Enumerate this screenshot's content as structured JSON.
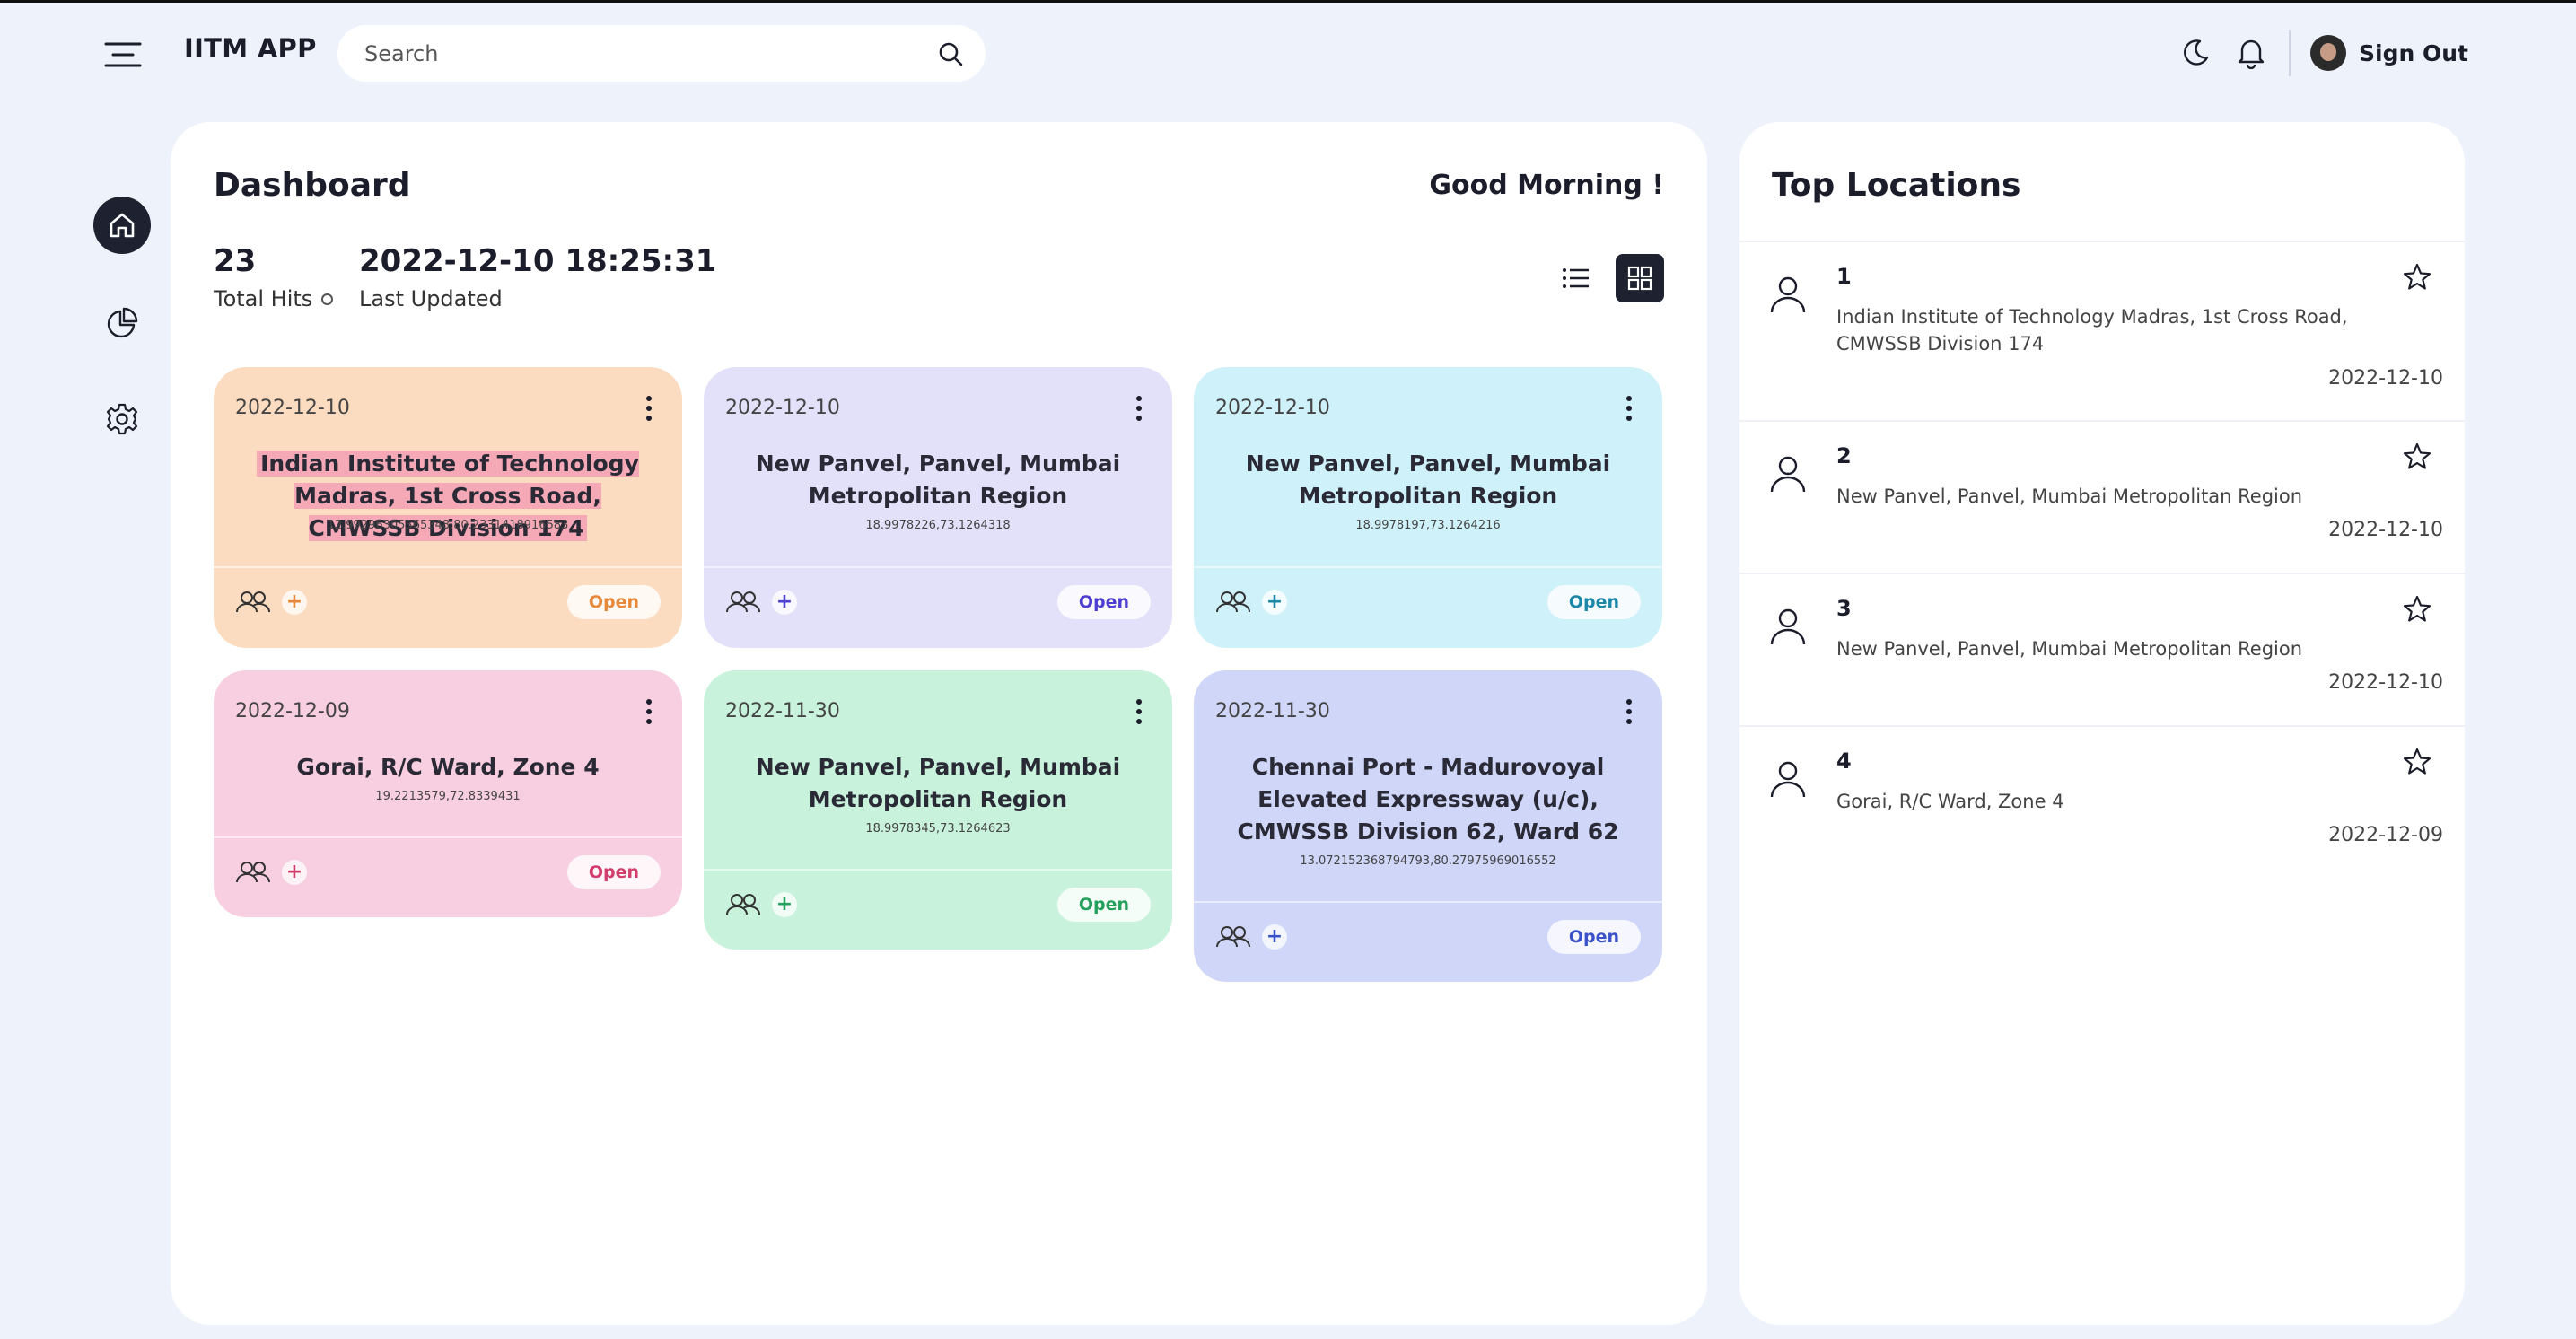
{
  "header": {
    "app_title": "IITM APP",
    "search_placeholder": "Search",
    "signout_label": "Sign Out"
  },
  "nav": {
    "items": [
      {
        "name": "home",
        "icon": "home-icon",
        "active": true
      },
      {
        "name": "analytics",
        "icon": "pie-chart-icon",
        "active": false
      },
      {
        "name": "settings",
        "icon": "gear-icon",
        "active": false
      }
    ]
  },
  "dashboard": {
    "title": "Dashboard",
    "greeting": "Good Morning !",
    "total_hits": "23",
    "total_hits_label": "Total Hits",
    "last_updated": "2022-12-10 18:25:31",
    "last_updated_label": "Last Updated",
    "cards": [
      {
        "date": "2022-12-10",
        "title": "Indian Institute of Technology Madras, 1st Cross Road, CMWSSB Division 174",
        "coords": "12.99296305365348,80.2331418916583",
        "open_label": "Open",
        "bg": "#fcdcc0",
        "accent": "#e8883a"
      },
      {
        "date": "2022-12-10",
        "title": "New Panvel, Panvel, Mumbai Metropolitan Region",
        "coords": "18.9978226,73.1264318",
        "open_label": "Open",
        "bg": "#e3e1fa",
        "accent": "#4d3fd1"
      },
      {
        "date": "2022-12-10",
        "title": "New Panvel, Panvel, Mumbai Metropolitan Region",
        "coords": "18.9978197,73.1264216",
        "open_label": "Open",
        "bg": "#cff1fa",
        "accent": "#1c87a8"
      },
      {
        "date": "2022-12-09",
        "title": "Gorai, R/C Ward, Zone 4",
        "coords": "19.2213579,72.8339431",
        "open_label": "Open",
        "bg": "#f8cfe0",
        "accent": "#d23e6c"
      },
      {
        "date": "2022-11-30",
        "title": "New Panvel, Panvel, Mumbai Metropolitan Region",
        "coords": "18.9978345,73.1264623",
        "open_label": "Open",
        "bg": "#c8f2db",
        "accent": "#23a05b"
      },
      {
        "date": "2022-11-30",
        "title": "Chennai Port - Madurovoyal Elevated Expressway (u/c), CMWSSB Division 62, Ward 62",
        "coords": "13.072152368794793,80.27975969016552",
        "open_label": "Open",
        "bg": "#cfd6f8",
        "accent": "#3a52c9"
      }
    ]
  },
  "top_locations": {
    "title": "Top Locations",
    "items": [
      {
        "rank": "1",
        "address": "Indian Institute of Technology Madras, 1st Cross Road, CMWSSB Division 174",
        "date": "2022-12-10"
      },
      {
        "rank": "2",
        "address": "New Panvel, Panvel, Mumbai Metropolitan Region",
        "date": "2022-12-10"
      },
      {
        "rank": "3",
        "address": "New Panvel, Panvel, Mumbai Metropolitan Region",
        "date": "2022-12-10"
      },
      {
        "rank": "4",
        "address": "Gorai, R/C Ward, Zone 4",
        "date": "2022-12-09"
      }
    ]
  }
}
